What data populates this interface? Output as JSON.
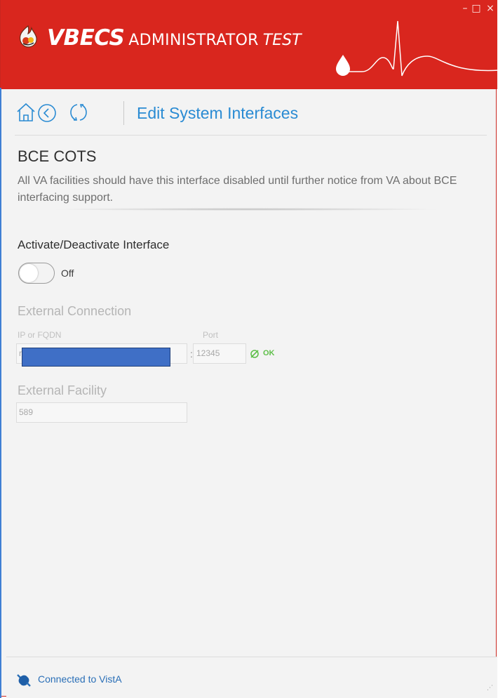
{
  "app": {
    "brand": "VBECS",
    "role": "ADMINISTRATOR",
    "environment": "TEST",
    "accent_color": "#d9261e"
  },
  "window_controls": {
    "minimize": "–",
    "maximize": "□",
    "close": "×"
  },
  "nav": {
    "home_icon": "home-icon",
    "back_icon": "back-circle-icon",
    "refresh_icon": "refresh-icon",
    "page_title": "Edit System Interfaces"
  },
  "section": {
    "title": "BCE COTS",
    "description": "All VA facilities should have this interface disabled until further notice from VA about BCE interfacing support."
  },
  "activation": {
    "label": "Activate/Deactivate Interface",
    "state": "Off",
    "enabled": false
  },
  "external_connection": {
    "title": "External Connection",
    "ip_label": "IP or FQDN",
    "ip_value_visible": "r",
    "separator": ":",
    "port_label": "Port",
    "port_value": "12345",
    "status_text": "OK",
    "status_color": "#5fbf4a"
  },
  "external_facility": {
    "title": "External Facility",
    "value": "589"
  },
  "statusbar": {
    "connection_text": "Connected to VistA",
    "icon": "plug-connected-icon"
  }
}
